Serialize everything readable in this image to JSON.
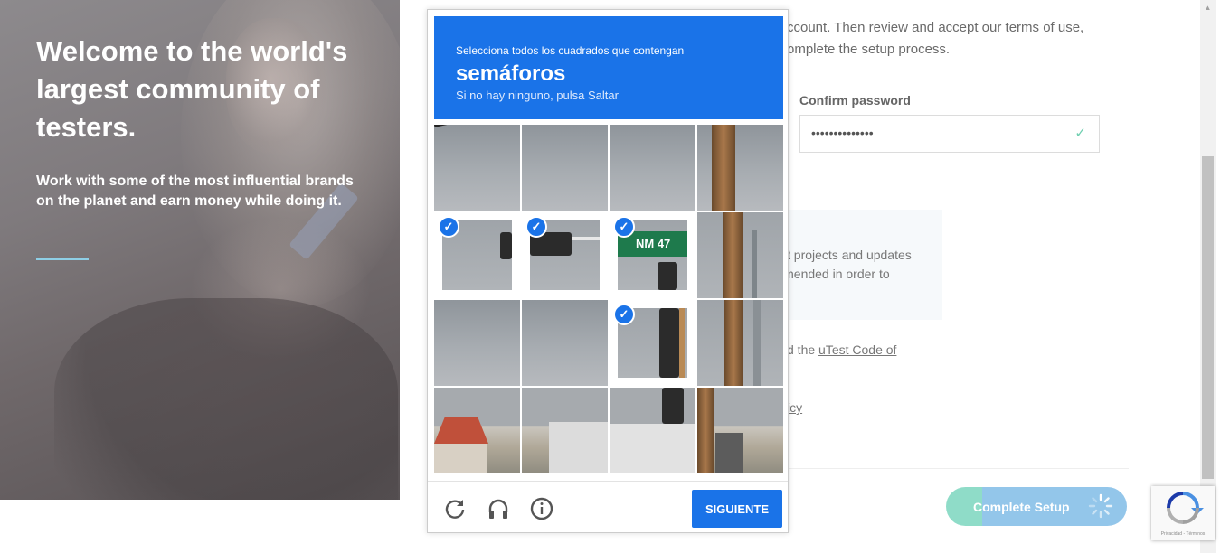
{
  "hero": {
    "title": "Welcome to the world's largest community of testers.",
    "subtitle": "Work with some of the most influential brands on the planet and earn money while doing it."
  },
  "form": {
    "intro_line1": "ccount. Then review and accept our terms of use,",
    "intro_line2": "omplete the setup process.",
    "confirm_password_label": "Confirm password",
    "confirm_password_value": "••••••••••••••",
    "info_text": "t projects and updates nended in order to",
    "code_prefix": "d the ",
    "code_link": "uTest Code of",
    "policy_link": "icy",
    "complete_button": "Complete Setup"
  },
  "captcha": {
    "instruction": "Selecciona todos los cuadrados que contengan",
    "keyword": "semáforos",
    "hint": "Si no hay ninguno, pulsa Saltar",
    "sign_text": "NM 47",
    "next_button": "SIGUIENTE",
    "icons": [
      "reload-icon",
      "audio-icon",
      "info-icon"
    ],
    "tiles_selected": [
      false,
      false,
      false,
      false,
      true,
      true,
      true,
      false,
      false,
      false,
      true,
      false,
      false,
      false,
      false,
      false
    ]
  },
  "recaptcha_badge": {
    "footer": "Privacidad - Términos"
  },
  "colors": {
    "captcha_blue": "#1a73e8",
    "hero_rule": "#8ecfe6",
    "button_green": "#8fdcc8",
    "button_blue": "#93c6ea"
  }
}
